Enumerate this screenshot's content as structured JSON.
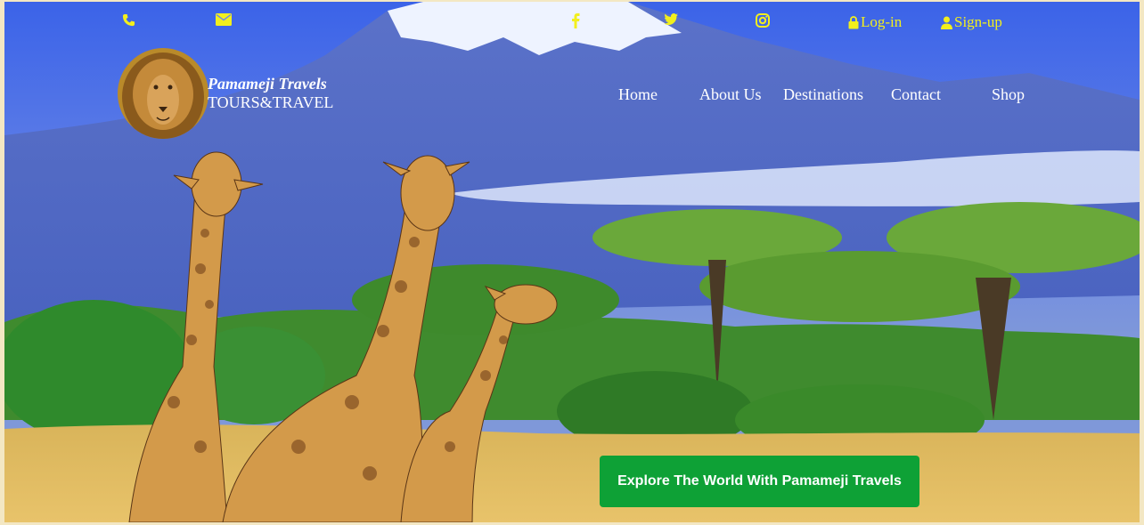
{
  "topbar": {
    "phone_icon": "phone-icon",
    "mail_icon": "envelope-icon",
    "facebook_icon": "facebook-icon",
    "twitter_icon": "twitter-icon",
    "instagram_icon": "instagram-icon",
    "login_label": "Log-in",
    "signup_label": "Sign-up",
    "accent_color": "#f2ef1d"
  },
  "brand": {
    "name": "Pamameji Travels",
    "tagline": "TOURS&TRAVEL"
  },
  "nav": {
    "items": [
      "Home",
      "About Us",
      "Destinations",
      "Contact",
      "Shop"
    ]
  },
  "hero": {
    "cta_label": "Explore The World With Pamameji Travels",
    "cta_color": "#0ea136"
  }
}
